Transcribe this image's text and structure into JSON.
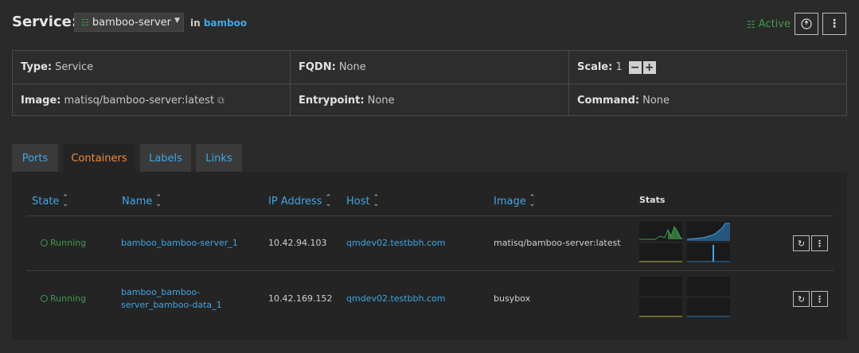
{
  "header": {
    "title": "Service:",
    "service_select": "bamboo-server",
    "in_label": "in",
    "stack_name": "bamboo",
    "state": "Active"
  },
  "info": {
    "type_label": "Type:",
    "type_value": "Service",
    "fqdn_label": "FQDN:",
    "fqdn_value": "None",
    "scale_label": "Scale:",
    "scale_value": "1",
    "image_label": "Image:",
    "image_value": "matisq/bamboo-server:latest",
    "entrypoint_label": "Entrypoint:",
    "entrypoint_value": "None",
    "command_label": "Command:",
    "command_value": "None"
  },
  "tabs": [
    "Ports",
    "Containers",
    "Labels",
    "Links"
  ],
  "table": {
    "headers": [
      "State",
      "Name",
      "IP Address",
      "Host",
      "Image",
      "Stats"
    ],
    "rows": [
      {
        "state": "Running",
        "name": "bamboo_bamboo-server_1",
        "ip": "10.42.94.103",
        "host": "qmdev02.testbbh.com",
        "image": "matisq/bamboo-server:latest"
      },
      {
        "state": "Running",
        "name_line1": "bamboo_bamboo-",
        "name_line2": "server_bamboo-data_1",
        "ip": "10.42.169.152",
        "host": "qmdev02.testbbh.com",
        "image": "busybox"
      }
    ]
  },
  "colors": {
    "accent_link": "#3fa6e6",
    "status_green": "#3e9b4b",
    "selected_tab": "#f08a3e",
    "stat_cpu": "#3e9b4b",
    "stat_mem": "#2f7fc1",
    "stat_net": "#c9b84a"
  },
  "icons": {
    "service": "network-icon",
    "copy": "copy-icon",
    "restart": "restart-icon",
    "more": "vertical-dots-icon",
    "help": "help-circle-icon"
  }
}
